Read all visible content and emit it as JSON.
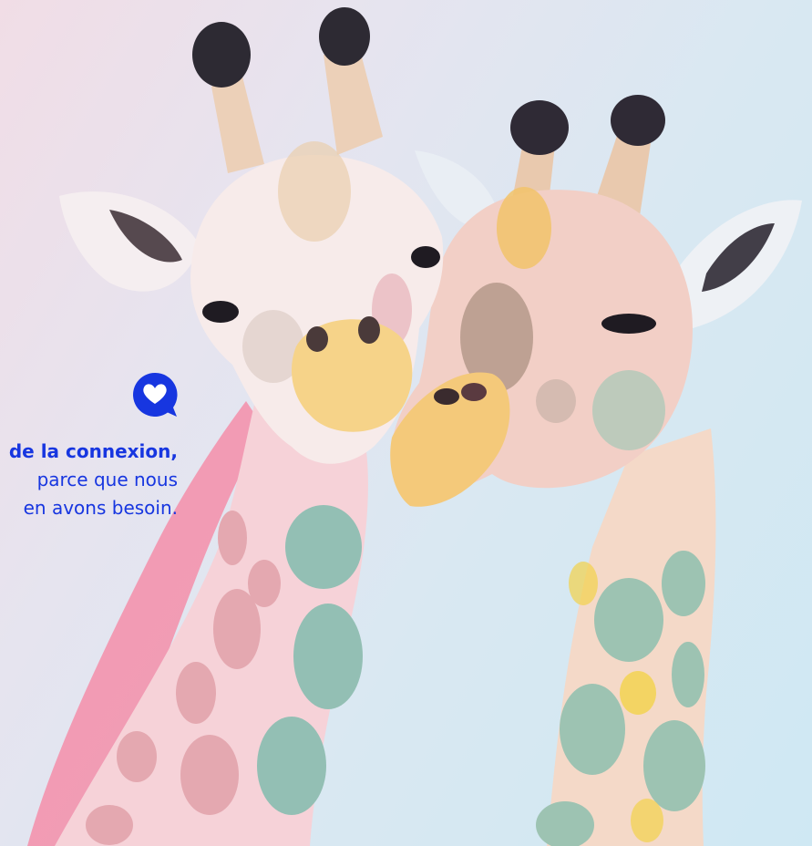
{
  "tagline": {
    "line1": "de la connexion,",
    "line2": "parce que nous",
    "line3": "en avons besoin."
  },
  "brand": {
    "icon": "chat-heart-icon",
    "color": "#1736e0"
  },
  "colors": {
    "background": "#dbe8f1",
    "giraffe_left_neck": "#f6cfd8",
    "giraffe_right_neck": "#f2d6c8",
    "spots_teal": "#8fbfb7",
    "spots_pink": "#e6aab2",
    "spots_yellow": "#f2d24a"
  }
}
